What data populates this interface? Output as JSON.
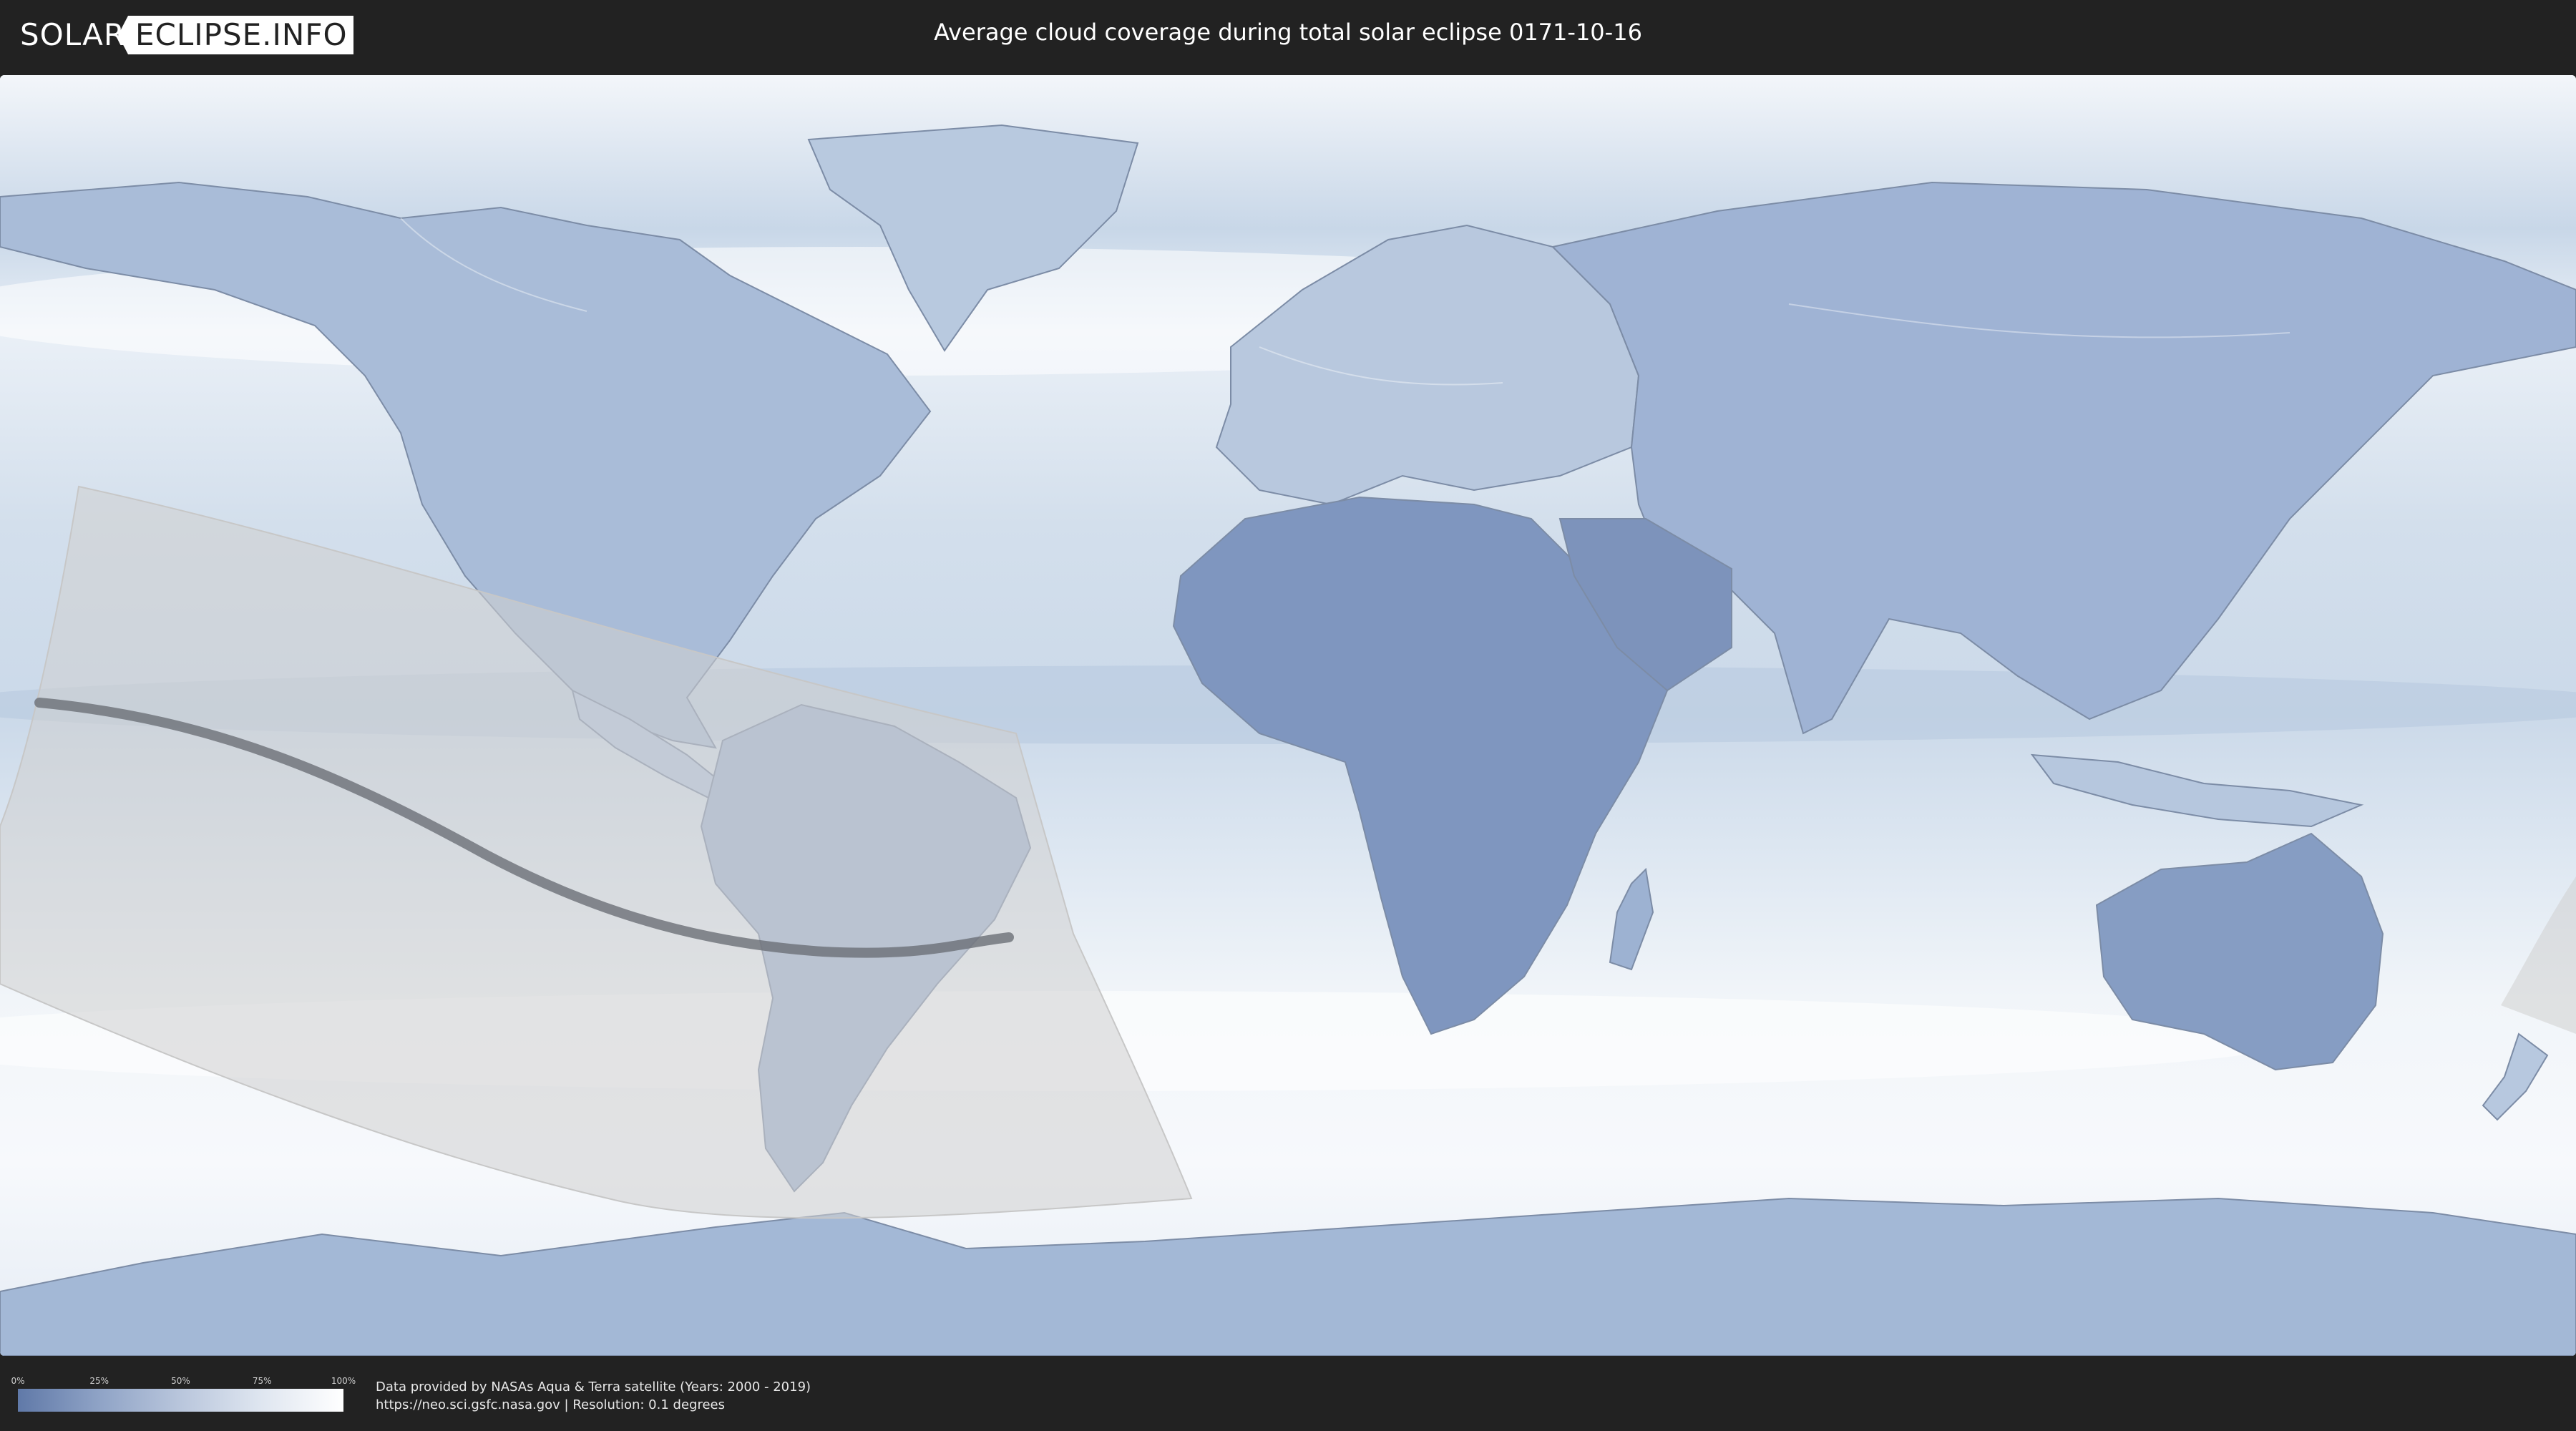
{
  "header": {
    "logo_left": "SOLAR",
    "logo_right": "ECLIPSE.INFO",
    "title": "Average cloud coverage during total solar eclipse 0171-10-16"
  },
  "legend": {
    "ticks": [
      "0%",
      "25%",
      "50%",
      "75%",
      "100%"
    ],
    "low_color": "#6079a8",
    "high_color": "#ffffff"
  },
  "credits": {
    "line1": "Data provided by NASAs Aqua & Terra satellite (Years: 2000 - 2019)",
    "line2": "https://neo.sci.gsfc.nasa.gov | Resolution: 0.1 degrees"
  },
  "map": {
    "projection": "equirectangular",
    "ocean_color": "#dbe5f0",
    "clear_land_color": "#7d93bb",
    "path_color": "#6b6f77",
    "shadow_color": "#cfcfcf"
  }
}
